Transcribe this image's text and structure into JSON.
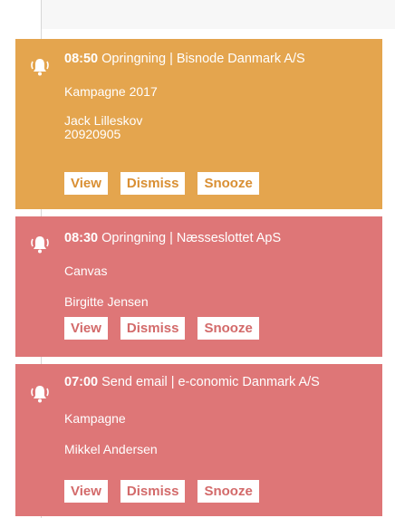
{
  "notifications": [
    {
      "time": "08:50",
      "title": " Opringning | Bisnode Danmark A/S",
      "campaign": "Kampagne 2017",
      "contact": "Jack Lilleskov",
      "phone": "20920905",
      "color": "#e4a54e",
      "icon": "bell-icon"
    },
    {
      "time": "08:30",
      "title": " Opringning | Næsseslottet ApS",
      "campaign": "Canvas",
      "contact": "Birgitte Jensen",
      "color": "#de7677",
      "icon": "bell-icon"
    },
    {
      "time": "07:00",
      "title": " Send email | e-conomic Danmark A/S",
      "campaign": "Kampagne",
      "contact": "Mikkel Andersen",
      "color": "#de7677",
      "icon": "bell-icon"
    }
  ],
  "buttons": {
    "view": "View",
    "dismiss": "Dismiss",
    "snooze": "Snooze"
  }
}
